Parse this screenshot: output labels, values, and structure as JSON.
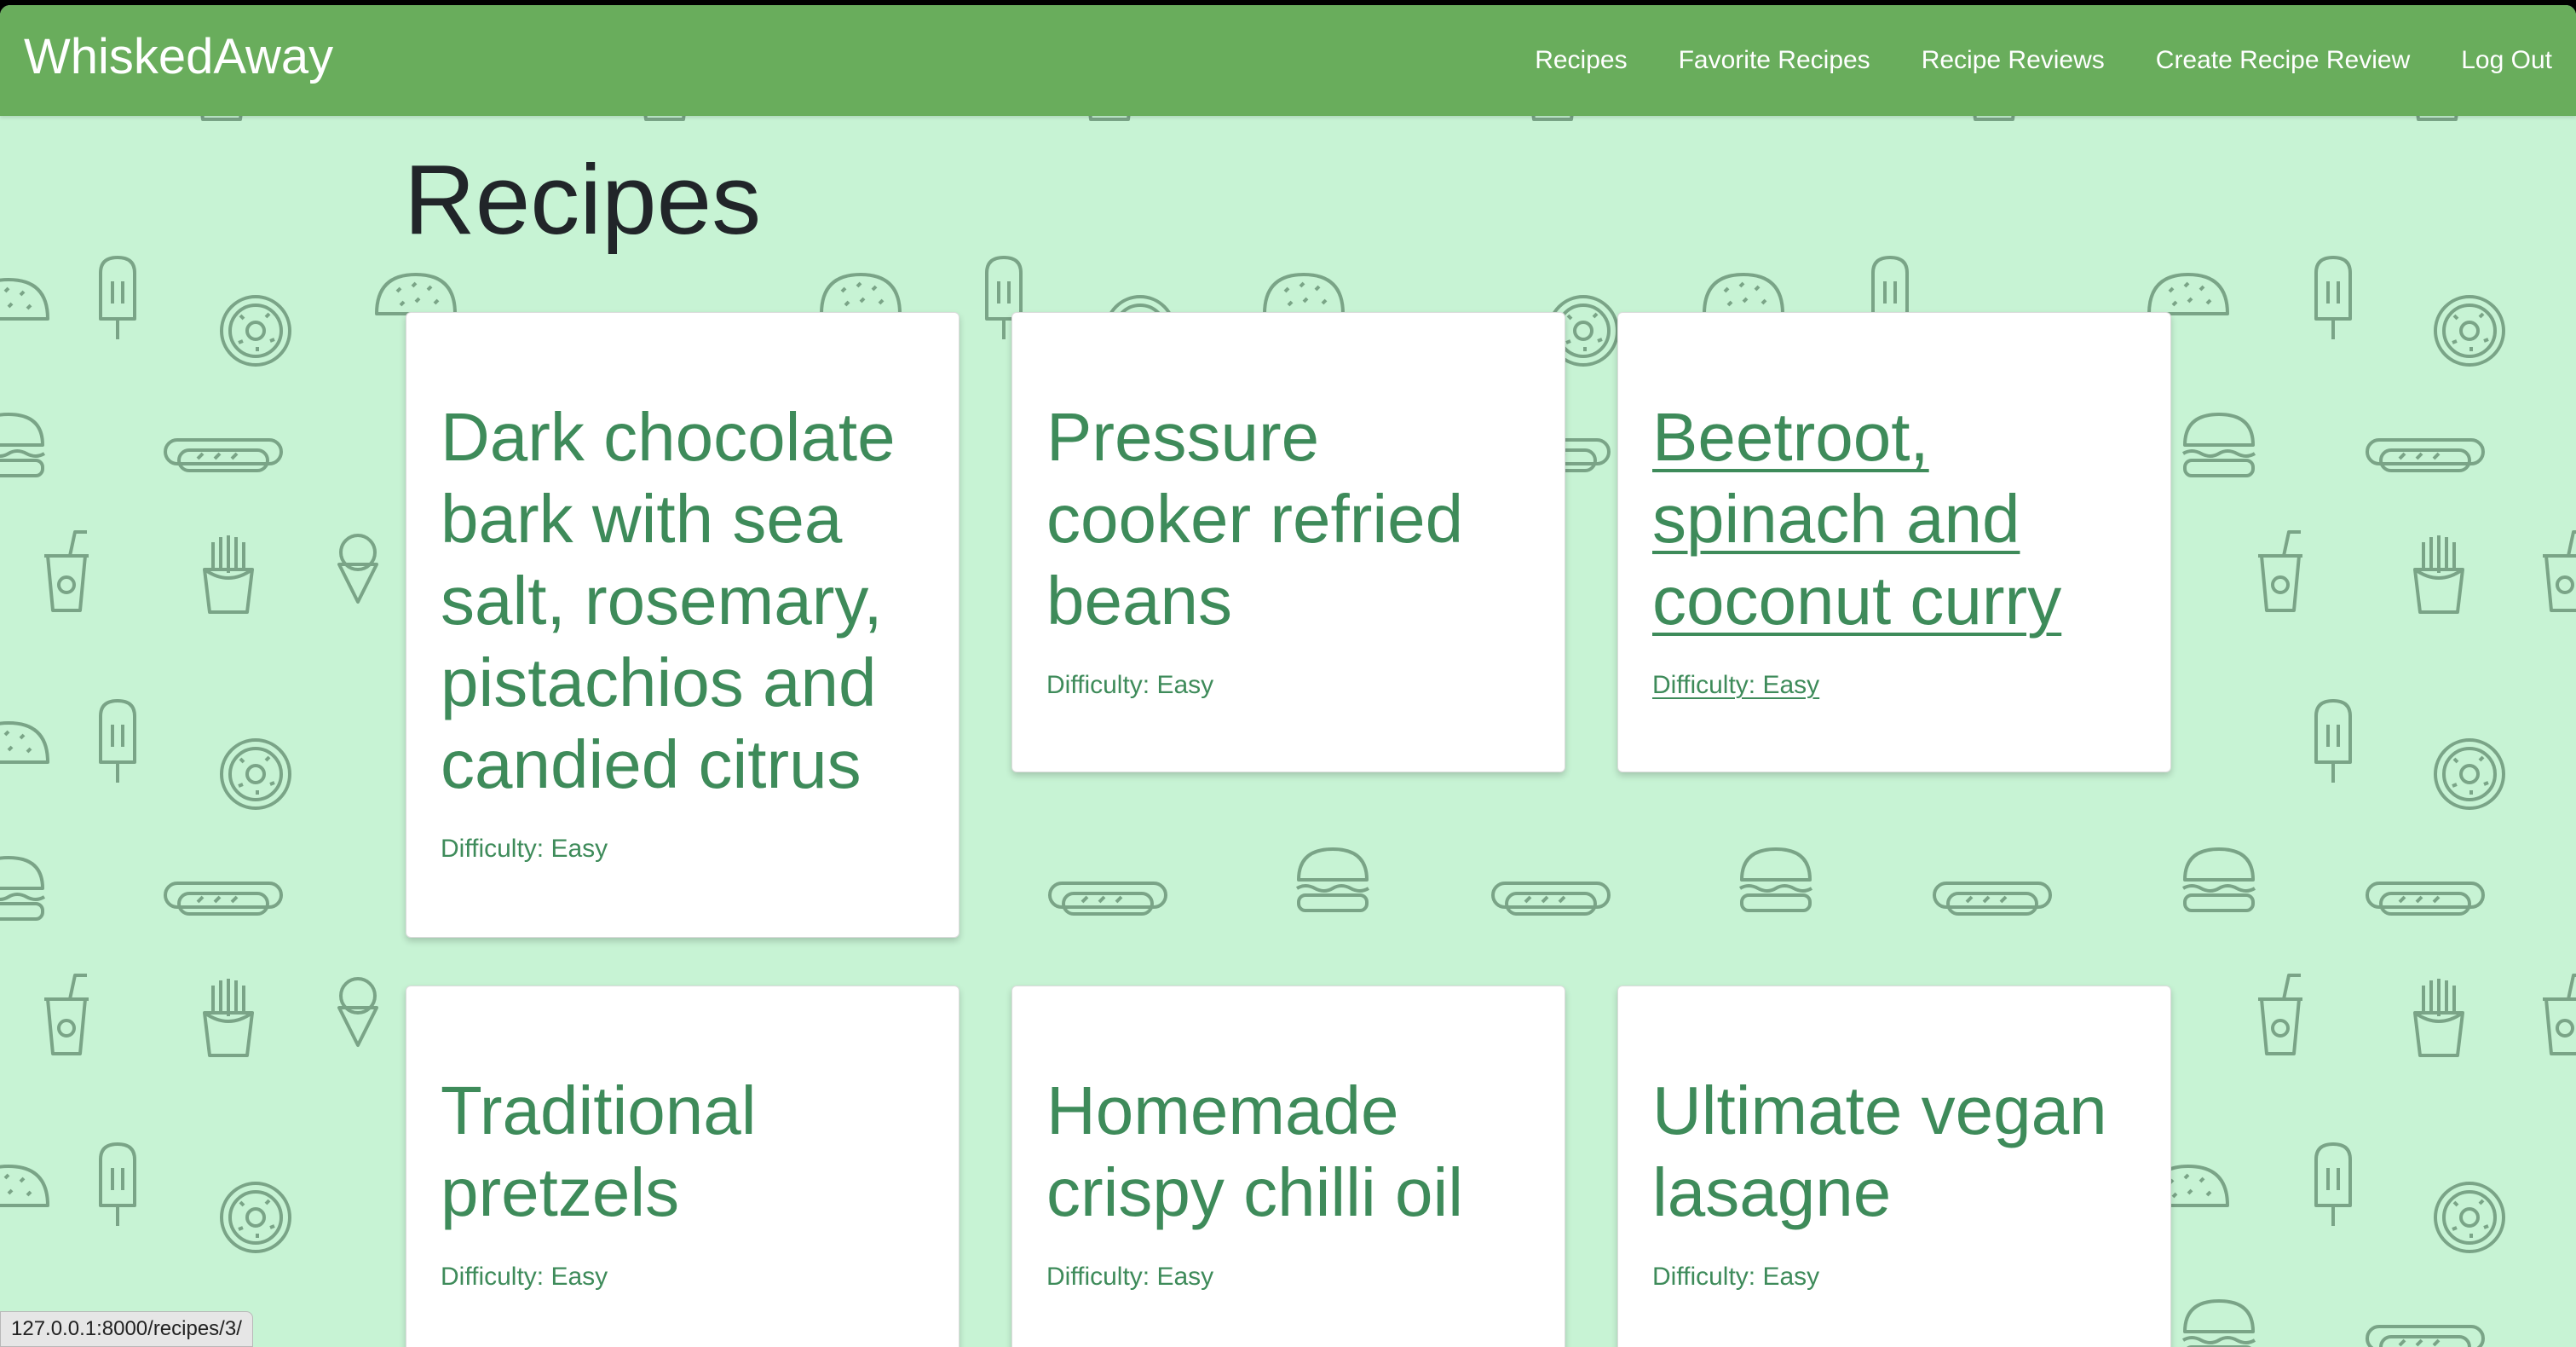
{
  "navbar": {
    "brand": "WhiskedAway",
    "links": [
      {
        "label": "Recipes"
      },
      {
        "label": "Favorite Recipes"
      },
      {
        "label": "Recipe Reviews"
      },
      {
        "label": "Create Recipe Review"
      },
      {
        "label": "Log Out"
      }
    ]
  },
  "page": {
    "title": "Recipes"
  },
  "recipes": [
    {
      "title": "Dark chocolate bark with sea salt, rosemary, pistachios and candied citrus",
      "difficulty": "Difficulty: Easy"
    },
    {
      "title": "Pressure cooker refried beans",
      "difficulty": "Difficulty: Easy"
    },
    {
      "title": "Beetroot, spinach and coconut curry",
      "difficulty": "Difficulty: Easy"
    },
    {
      "title": "Traditional pretzels",
      "difficulty": "Difficulty: Easy"
    },
    {
      "title": "Homemade crispy chilli oil",
      "difficulty": "Difficulty: Easy"
    },
    {
      "title": "Ultimate vegan lasagne",
      "difficulty": "Difficulty: Easy"
    }
  ],
  "status_bar": {
    "url": "127.0.0.1:8000/recipes/3/"
  },
  "colors": {
    "navbar": "#69ad5c",
    "background": "#c7f3d4",
    "accent_text": "#3e8b5a",
    "pattern_stroke": "#7aa487"
  },
  "background_icons": [
    "fries-icon",
    "cone-icon",
    "cup-icon",
    "popsicle-icon",
    "taco-icon",
    "donut-icon",
    "hotdog-icon",
    "burger-icon",
    "ice-cream-icon",
    "soda-icon"
  ]
}
